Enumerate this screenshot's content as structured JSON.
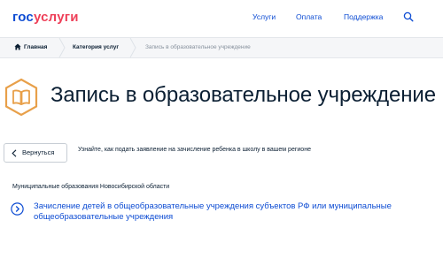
{
  "header": {
    "logo_part1": "гос",
    "logo_part2": "услуги",
    "nav": [
      "Услуги",
      "Оплата",
      "Поддержка"
    ],
    "search_icon": "search-icon"
  },
  "breadcrumb": {
    "home": "Главная",
    "category": "Категория услуг",
    "current": "Запись в образовательное учреждение"
  },
  "page": {
    "title": "Запись в образовательное учреждение",
    "title_icon": "book-icon",
    "back_label": "Вернуться",
    "info": "Узнайте, как подать заявление на зачисление ребенка в школу в вашем регионе",
    "section_label": "Муниципальные образования Новосибирской области",
    "service_link": "Зачисление детей в общеобразовательные учреждения субъектов РФ или муниципальные общеобразовательные учреждения"
  },
  "colors": {
    "brand_blue": "#0d4cd3",
    "brand_red": "#ee3f58",
    "accent_orange": "#e8a04a",
    "text": "#0b1f33"
  }
}
